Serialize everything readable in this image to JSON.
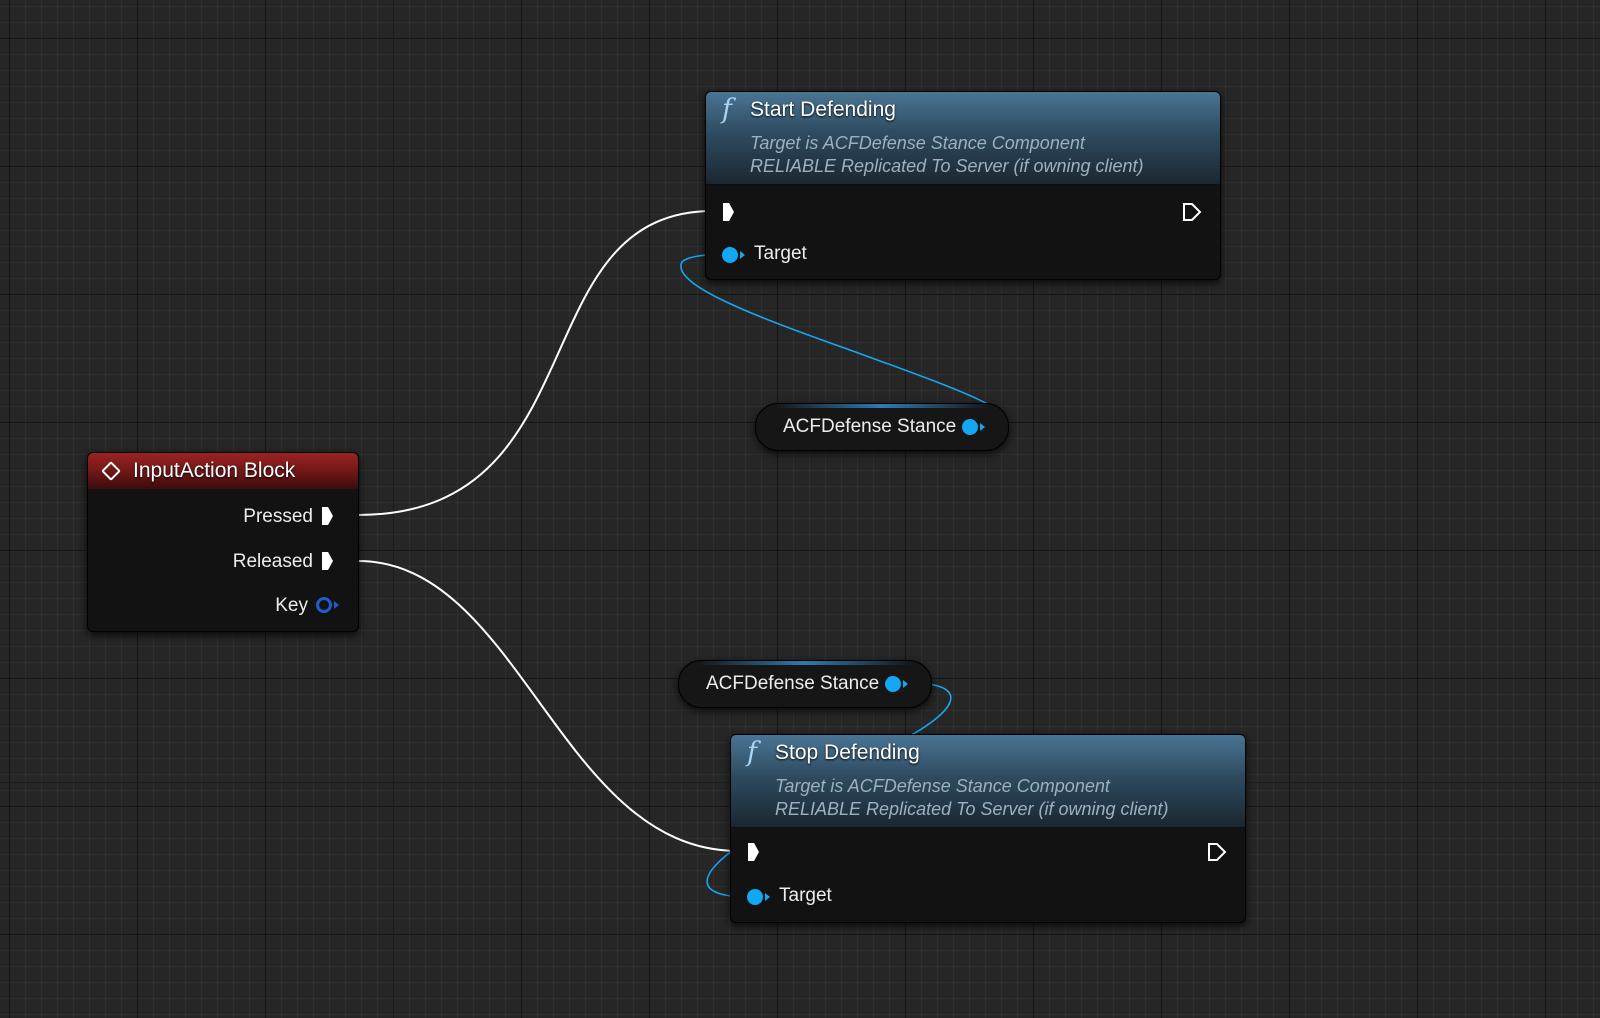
{
  "graph": {
    "input_action_node": {
      "title": "InputAction Block",
      "pins": {
        "pressed": "Pressed",
        "released": "Released",
        "key": "Key"
      }
    },
    "start_defending_node": {
      "icon": "function-icon",
      "title": "Start Defending",
      "subtitle_line1": "Target is ACFDefense Stance Component",
      "subtitle_line2": "RELIABLE Replicated To Server (if owning client)",
      "target_label": "Target"
    },
    "stop_defending_node": {
      "icon": "function-icon",
      "title": "Stop Defending",
      "subtitle_line1": "Target is ACFDefense Stance Component",
      "subtitle_line2": "RELIABLE Replicated To Server (if owning client)",
      "target_label": "Target"
    },
    "variable_top": {
      "label": "ACFDefense Stance"
    },
    "variable_bottom": {
      "label": "ACFDefense Stance"
    }
  },
  "colors": {
    "exec_wire": "#ffffff",
    "object_wire": "#14a7f2",
    "event_header": "#9c2323",
    "function_header": "#4a7594"
  }
}
